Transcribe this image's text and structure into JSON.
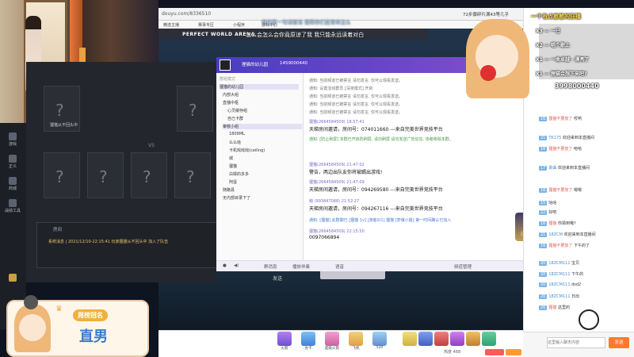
{
  "browser": {
    "url": "douyu.com/8336510",
    "ticket_text": "72步骤碎片满43等几乎",
    "bookmarks": [
      "精选主播",
      "赛事专区",
      "小程序",
      "游戏中心"
    ]
  },
  "game": {
    "title": "PERFECT WORLD ARENA",
    "side_icons": [
      "游戏",
      "正义",
      "商城",
      "荣誉",
      "伙伴",
      "战绩工具"
    ],
    "slot_label": "观战位",
    "vs_label": "VS",
    "log_header": "房间",
    "log_line": "系统消息 | 2021/12/10-22:15:41 玩家狸猫从不回头中 加入了队伍",
    "send_label": "发送",
    "player_tag": "狸猫从不回头中"
  },
  "overlay_danmaku": {
    "line1": "怎么会怎么会你竟原谅了我 我只能永远读着对白",
    "line2": "他的第一句话被当  我和你们是曾来怎么"
  },
  "chat": {
    "group_name": "狸猫的幼儿园",
    "group_id": "1459000440",
    "tree": [
      "群组模式",
      "狸猫的幼儿园",
      "内部大组",
      "直播中枢",
      "心灵缓存组",
      "自己卡群",
      "审核小组",
      "1809ML",
      "么么哒",
      "卡机戏戏戏(ceiling)",
      "城",
      "狸猫",
      "白嫖的多多",
      "阿蛋",
      "随路县",
      "无内部目录下了"
    ],
    "notices": [
      "通知: 当前频道已被禁言 请勿发言, 仅可以观看发送。",
      "通知: 设置活动群员 [深夜模式] 开启",
      "通知: 当前频道已被禁言 请勿发言, 仅可以观看发送。",
      "通知: 当前频道已被禁言 请勿发言, 仅可以观看发送。",
      "通知: 当前频道已被禁言 请勿发言, 仅可以观看发送。"
    ],
    "msgs": [
      {
        "meta": "狸猫(2664584509) 18:57:41",
        "text": "天梯房间邀请，房间号：074011660  ---来自完美世界竞技平台"
      },
      {
        "meta": "通知: [防止刷屏] 本群已开启防刷屏, 请勿刷屏 请勿发送广告信息, 违者移除本群。",
        "text": ""
      },
      {
        "meta": "狸猫(2664584509) 21:47:02",
        "text": "警告，两边出队友你将被踢出游戏!"
      },
      {
        "meta": "狸猫(2664584509) 21:47:09",
        "text": "天梯房间邀请，房间号：094269580  ---来自完美世界竞技平台"
      },
      {
        "meta": "萌 (993847088) 21:52:27",
        "text": "天梯房间邀请，房间号：094267116  ---来自完美世界竞技平台"
      },
      {
        "meta": "通知: [狸猫] 此群聊已 [狸猫 1v] [游客0/1] 狸猫 [梦魂小姐] 第一时间确认已加入",
        "text": ""
      },
      {
        "meta": "狸猫(2664584509) 22:15:50",
        "text": "0097066894"
      }
    ],
    "footer": [
      "群消息",
      "全体禁言",
      "播放伴奏",
      "语音"
    ],
    "footer_right": "频道管理",
    "pass_badge": "段位 分段"
  },
  "right_panel": {
    "top_danmaku": [
      "一个有点憨憨的狂播",
      "X3 — 一巳",
      "X2 — 唱个歌上",
      "X1 — 一曲卓越 · 漂亮了",
      "X1 — 狸猫会想下来吧?"
    ],
    "big_number": "3998000440",
    "entries": [
      {
        "lv": "16",
        "nick": "狸猫不要放了",
        "text": "哎哟"
      },
      {
        "lv": "21",
        "nick": "TK175",
        "text": "欢迎来到本直播间"
      },
      {
        "lv": "16",
        "nick": "狸猫不要放了",
        "text": "哈哈"
      },
      {
        "lv": "17",
        "nick": "歌曲",
        "text": "欢迎来到本直播间"
      },
      {
        "lv": "16",
        "nick": "狸猫不要放了",
        "text": "嗯嗯"
      },
      {
        "lv": "15",
        "nick": "咕咕",
        "text": ""
      },
      {
        "lv": "22",
        "nick": "好吧",
        "text": ""
      },
      {
        "lv": "16",
        "nick": "狸猫",
        "text": "你猜到哦?"
      },
      {
        "lv": "21",
        "nick": "18ZCM",
        "text": "欢迎来到本直播间"
      },
      {
        "lv": "16",
        "nick": "狸猫不要放了",
        "text": "下午的了"
      },
      {
        "lv": "20",
        "nick": "18ZCM111",
        "text": "宝贝"
      },
      {
        "lv": "20",
        "nick": "18ZCM111",
        "text": "下午的"
      },
      {
        "lv": "20",
        "nick": "18ZCM111",
        "text": "dsd2"
      },
      {
        "lv": "20",
        "nick": "18ZCM111",
        "text": "日出"
      },
      {
        "lv": "20",
        "nick": "狸猫",
        "text": "这里的"
      }
    ],
    "send_placeholder": "这里输入聊天内容",
    "send_btn": "发送"
  },
  "bottom": {
    "gifts": [
      "火箭",
      "办卡",
      "超级火箭",
      "飞机",
      "520",
      "酒",
      "粉丝",
      "礼物",
      "宝箱"
    ],
    "fans": "热度 488"
  },
  "sticker": {
    "title": "周榜冠名",
    "name": "直男"
  },
  "colors": {
    "chat_header": "#6a45c8",
    "danmaku_red": "#e06060",
    "level_blue": "#7bb4e8"
  }
}
